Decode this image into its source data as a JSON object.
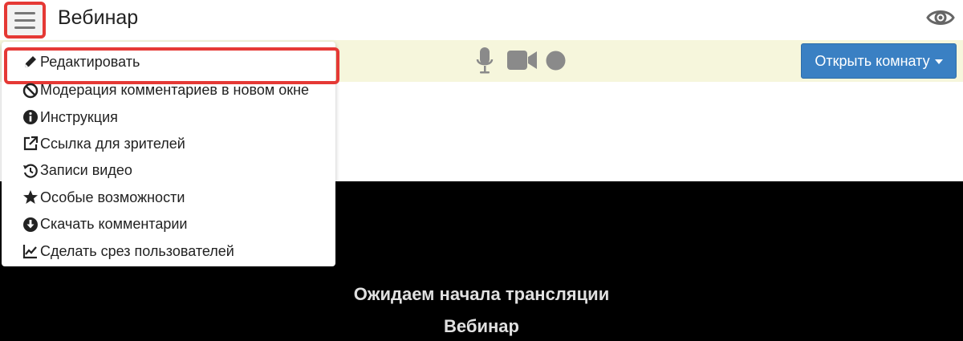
{
  "header": {
    "title": "Вебинар",
    "menu_icon": "hamburger-icon",
    "view_icon": "eye-icon"
  },
  "toolbar": {
    "mic_icon": "microphone-icon",
    "camera_icon": "video-camera-icon",
    "record_icon": "circle-icon",
    "open_room_label": "Открыть комнату"
  },
  "menu": {
    "items": [
      {
        "label": "Редактировать",
        "icon": "pencil-icon"
      },
      {
        "label": "Модерация комментариев в новом окне",
        "icon": "ban-icon"
      },
      {
        "label": "Инструкция",
        "icon": "info-circle-icon"
      },
      {
        "label": "Ссылка для зрителей",
        "icon": "external-link-icon"
      },
      {
        "label": "Записи видео",
        "icon": "history-icon"
      },
      {
        "label": "Особые возможности",
        "icon": "star-icon"
      },
      {
        "label": "Скачать комментарии",
        "icon": "download-circle-icon"
      },
      {
        "label": "Сделать срез пользователей",
        "icon": "line-chart-icon"
      }
    ]
  },
  "video": {
    "waiting_text": "Ожидаем начала трансляции",
    "event_name": "Вебинар"
  },
  "colors": {
    "highlight": "#e53935",
    "toolbar_bg": "#f6f6dc",
    "button_blue": "#3a80c3",
    "video_bg": "#000000"
  }
}
